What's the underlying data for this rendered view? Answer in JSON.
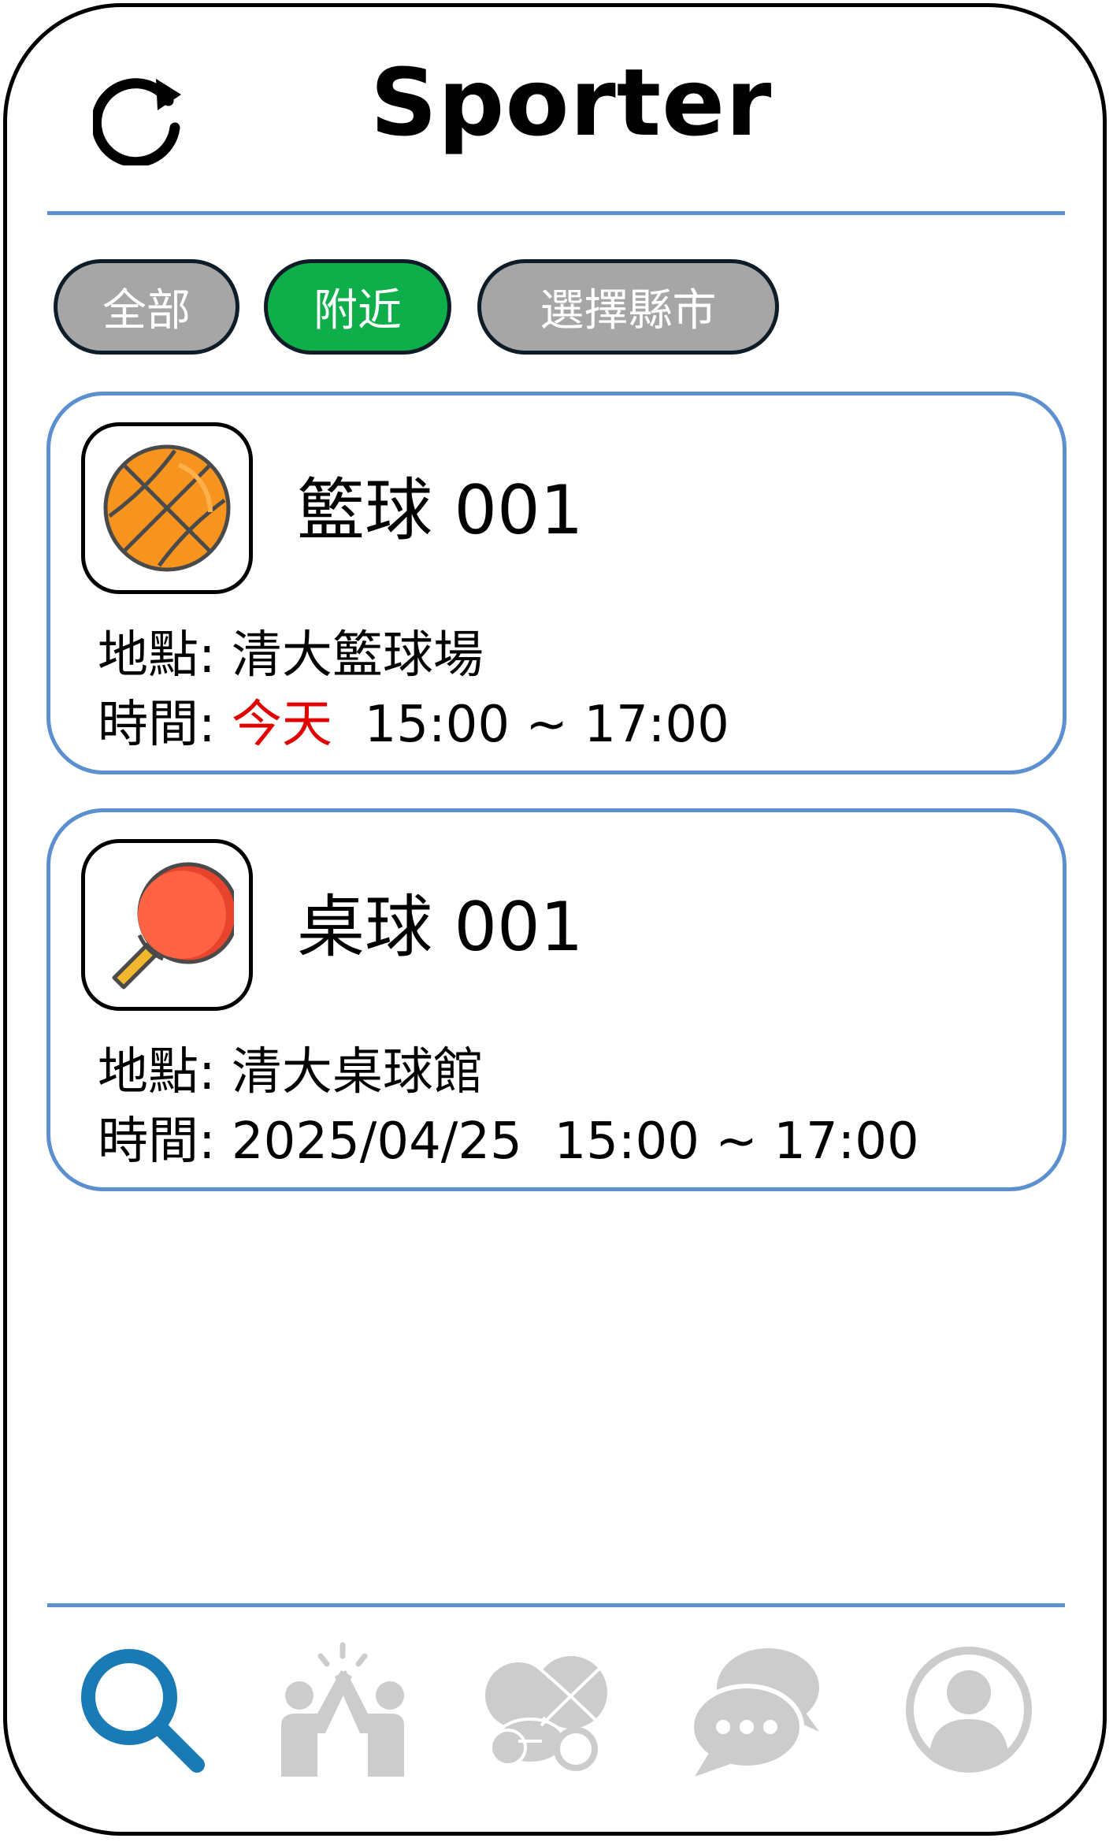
{
  "header": {
    "title": "Sporter",
    "refresh_icon": "refresh-icon"
  },
  "filters": {
    "all": "全部",
    "nearby": "附近",
    "select_city": "選擇縣市",
    "active": "附近"
  },
  "events": [
    {
      "icon": "basketball-icon",
      "name": "籃球 001",
      "location_label": "地點:",
      "location": "清大籃球場",
      "time_label": "時間:",
      "date": "今天",
      "date_highlight": true,
      "time": "15:00 ~ 17:00"
    },
    {
      "icon": "ping-pong-icon",
      "name": "桌球 001",
      "location_label": "地點:",
      "location": "清大桌球館",
      "time_label": "時間:",
      "date": "2025/04/25",
      "date_highlight": false,
      "time": "15:00 ~ 17:00"
    }
  ],
  "bottom_nav": [
    {
      "icon": "search-icon",
      "active": true
    },
    {
      "icon": "high-five-icon",
      "active": false
    },
    {
      "icon": "sports-balls-icon",
      "active": false
    },
    {
      "icon": "chat-icon",
      "active": false
    },
    {
      "icon": "profile-icon",
      "active": false
    }
  ],
  "colors": {
    "accent_blue": "#5b8fd0",
    "active_chip": "#0eae4a",
    "inactive_chip": "#a6a6a6",
    "today_red": "#e00000",
    "nav_active": "#1a7ab5",
    "nav_inactive": "#cccccc"
  }
}
